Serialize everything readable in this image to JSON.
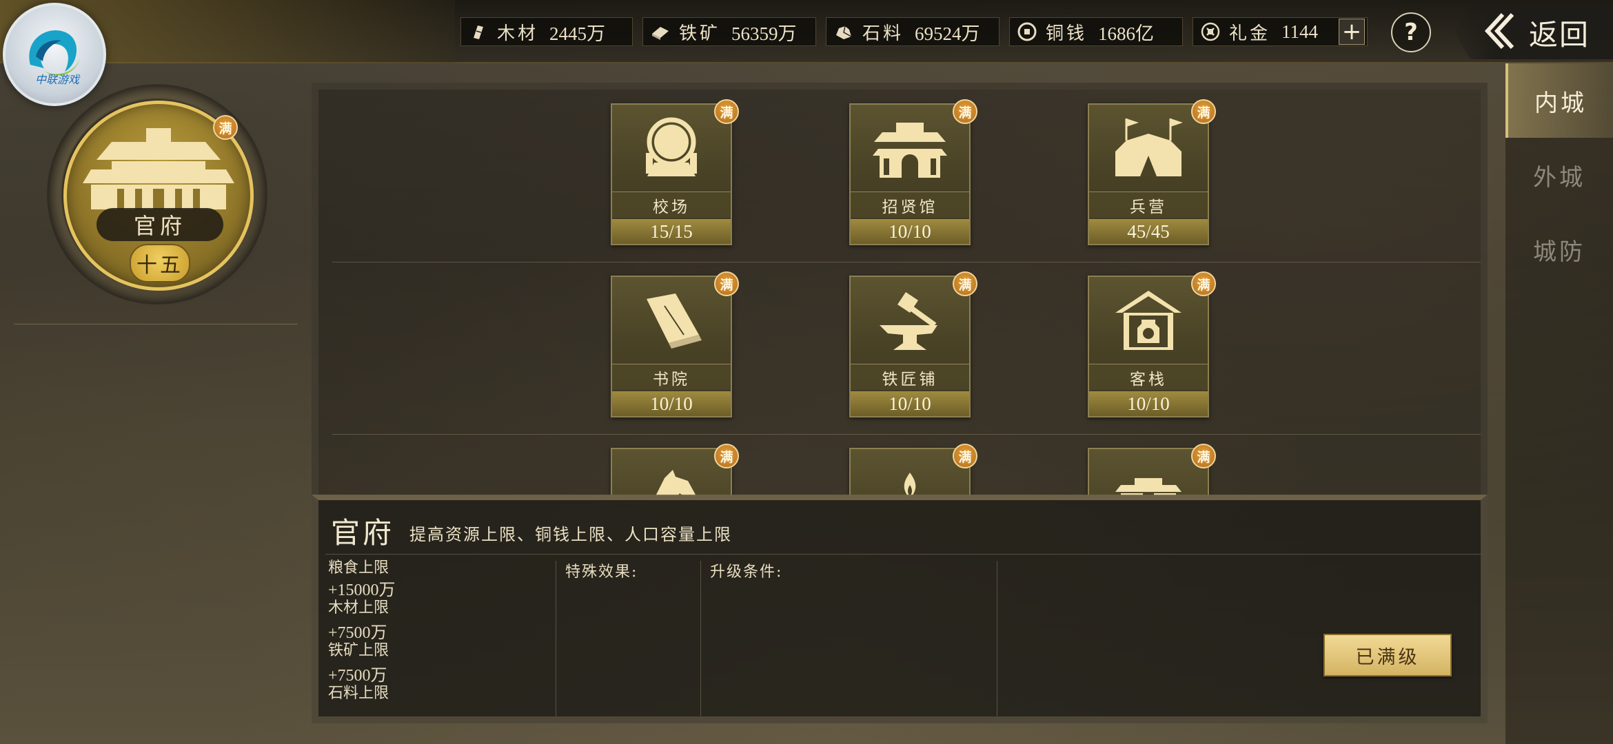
{
  "logo": {
    "text": "中联游戏"
  },
  "resources": [
    {
      "name": "木材",
      "value": "2445万",
      "icon": "wood-icon"
    },
    {
      "name": "铁矿",
      "value": "56359万",
      "icon": "iron-icon"
    },
    {
      "name": "石料",
      "value": "69524万",
      "icon": "stone-icon"
    },
    {
      "name": "铜钱",
      "value": "1686亿",
      "icon": "coin-icon"
    },
    {
      "name": "礼金",
      "value": "1144",
      "icon": "gift-money-icon"
    }
  ],
  "topbar": {
    "plus": "+",
    "help": "?",
    "back_label": "返回"
  },
  "main_building": {
    "name": "官府",
    "level": "十五",
    "badge": "满"
  },
  "tabs": [
    {
      "label": "内城",
      "active": true
    },
    {
      "label": "外城",
      "active": false
    },
    {
      "label": "城防",
      "active": false
    }
  ],
  "buildings": [
    {
      "name": "校场",
      "level": "15/15",
      "badge": "满",
      "icon": "mirror-icon"
    },
    {
      "name": "招贤馆",
      "level": "10/10",
      "badge": "满",
      "icon": "hall-icon"
    },
    {
      "name": "兵营",
      "level": "45/45",
      "badge": "满",
      "icon": "tent-icon"
    },
    {
      "name": "书院",
      "level": "10/10",
      "badge": "满",
      "icon": "book-icon"
    },
    {
      "name": "铁匠铺",
      "level": "10/10",
      "badge": "满",
      "icon": "anvil-hammer-icon"
    },
    {
      "name": "客栈",
      "level": "10/10",
      "badge": "满",
      "icon": "inn-wine-icon"
    },
    {
      "name": "",
      "level": "",
      "badge": "满",
      "icon": "horse-head-icon"
    },
    {
      "name": "",
      "level": "",
      "badge": "满",
      "icon": "flame-icon"
    },
    {
      "name": "",
      "level": "",
      "badge": "满",
      "icon": "gate-icon"
    }
  ],
  "info": {
    "title": "官府",
    "description": "提高资源上限、铜钱上限、人口容量上限",
    "stats": {
      "line1": "粮食上限",
      "line2": "+15000万",
      "line3": "木材上限",
      "line4": "+7500万",
      "line5": "铁矿上限",
      "line6": "+7500万",
      "line7": "石料上限"
    },
    "special_label": "特殊效果:",
    "upgrade_label": "升级条件:",
    "button_label": "已满级"
  },
  "colors": {
    "gold": "#e5c35f",
    "badge_orange": "#d08a2c",
    "panel_dark": "#1a1814"
  }
}
